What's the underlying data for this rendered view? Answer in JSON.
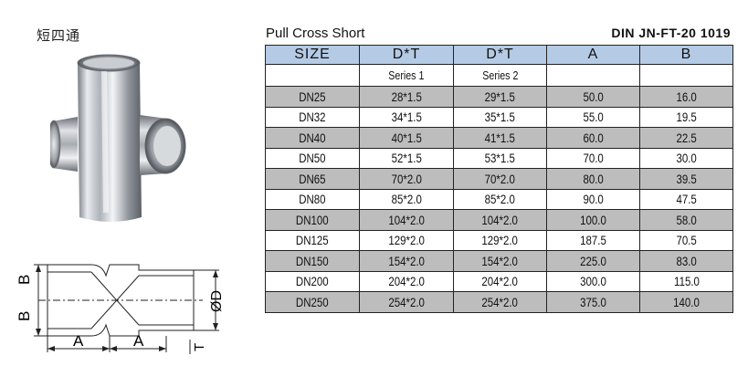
{
  "product_name_cn": "短四通",
  "table": {
    "title": "Pull Cross Short",
    "code": "DIN  JN-FT-20 1019",
    "headers": [
      "SIZE",
      "D*T",
      "D*T",
      "A",
      "B"
    ],
    "subheaders": [
      "",
      "Series 1",
      "Series 2",
      "",
      ""
    ],
    "rows": [
      [
        "DN25",
        "28*1.5",
        "29*1.5",
        "50.0",
        "16.0"
      ],
      [
        "DN32",
        "34*1.5",
        "35*1.5",
        "55.0",
        "19.5"
      ],
      [
        "DN40",
        "40*1.5",
        "41*1.5",
        "60.0",
        "22.5"
      ],
      [
        "DN50",
        "52*1.5",
        "53*1.5",
        "70.0",
        "30.0"
      ],
      [
        "DN65",
        "70*2.0",
        "70*2.0",
        "80.0",
        "39.5"
      ],
      [
        "DN80",
        "85*2.0",
        "85*2.0",
        "90.0",
        "47.5"
      ],
      [
        "DN100",
        "104*2.0",
        "104*2.0",
        "100.0",
        "58.0"
      ],
      [
        "DN125",
        "129*2.0",
        "129*2.0",
        "187.5",
        "70.5"
      ],
      [
        "DN150",
        "154*2.0",
        "154*2.0",
        "225.0",
        "83.0"
      ],
      [
        "DN200",
        "204*2.0",
        "204*2.0",
        "300.0",
        "115.0"
      ],
      [
        "DN250",
        "254*2.0",
        "254*2.0",
        "375.0",
        "140.0"
      ]
    ]
  },
  "drawing_labels": {
    "b_top": "B",
    "b_bottom": "B",
    "a_left": "A",
    "a_right": "A",
    "d": "ØD",
    "t": "T"
  },
  "colors": {
    "header_blue": "#b5cbe5",
    "row_gray": "#bdbdbd"
  },
  "icons": {
    "product_photo": "stainless-cross-fitting-photo",
    "drawing": "cross-fitting-technical-drawing"
  }
}
